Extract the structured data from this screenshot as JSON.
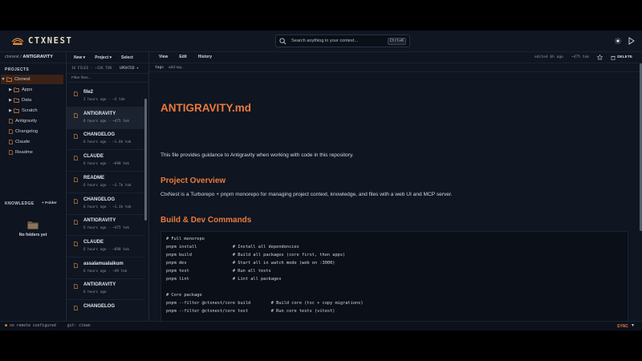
{
  "app": {
    "name": "CTXNEST"
  },
  "search": {
    "placeholder": "Search anything in your context...",
    "shortcut": "Ctrl+K"
  },
  "breadcrumb": {
    "root": "ctxnest",
    "separator": "/",
    "current": "ANTIGRAVITY"
  },
  "list_toolbar": {
    "new_label": "New ▾",
    "project_label": "Project ▾",
    "select_label": "Select"
  },
  "sidebar": {
    "projects_title": "PROJECTS",
    "items": [
      {
        "label": "Ctxnest",
        "type": "folder",
        "expanded": true,
        "active": true
      },
      {
        "label": "Apps",
        "type": "folder"
      },
      {
        "label": "Data",
        "type": "folder"
      },
      {
        "label": "Scratch",
        "type": "folder"
      },
      {
        "label": "Antigravity",
        "type": "file"
      },
      {
        "label": "Changelog",
        "type": "file"
      },
      {
        "label": "Claude",
        "type": "file"
      },
      {
        "label": "Readme",
        "type": "file"
      }
    ],
    "knowledge_title": "KNOWLEDGE",
    "add_folder_label": "+ Folder",
    "empty_text": "No folders yet"
  },
  "file_list": {
    "count_label": "16 FILES · ~11K TOK",
    "sort_label": "UPDATED ▾",
    "filter_placeholder": "Filter files...",
    "files": [
      {
        "name": "file2",
        "meta": "2 hours ago · ~3 tok"
      },
      {
        "name": "ANTIGRAVITY",
        "meta": "6 hours ago · ~475 tok",
        "active": true
      },
      {
        "name": "CHANGELOG",
        "meta": "6 hours ago · ~1.6k tok"
      },
      {
        "name": "CLAUDE",
        "meta": "6 hours ago · ~698 tok"
      },
      {
        "name": "README",
        "meta": "6 hours ago · ~3.7k tok"
      },
      {
        "name": "CHANGELOG",
        "meta": "6 hours ago · ~1.3k tok"
      },
      {
        "name": "ANTIGRAVITY",
        "meta": "6 hours ago · ~475 tok"
      },
      {
        "name": "CLAUDE",
        "meta": "6 hours ago · ~698 tok"
      },
      {
        "name": "assalamualaikum",
        "meta": "6 hours ago · ~49 tok"
      },
      {
        "name": "ANTIGRAVITY",
        "meta": "6 hours ago"
      },
      {
        "name": "CHANGELOG",
        "meta": ""
      }
    ]
  },
  "editor_toolbar": {
    "tabs": [
      "View",
      "Edit",
      "History"
    ],
    "edited": "edited 6h ago",
    "tokens": "~475 tok",
    "delete_label": "DELETE"
  },
  "tags": {
    "label": "tags",
    "add_label": "add tag..."
  },
  "document": {
    "title": "ANTIGRAVITY.md",
    "intro": "This file provides guidance to Antigravity when working with code in this repository.",
    "section1_title": "Project Overview",
    "section1_text": "CtxNest is a Turborepo + pnpm monorepo for managing project context, knowledge, and files with a web UI and MCP server.",
    "section2_title": "Build & Dev Commands",
    "code_lines": [
      "# Full monorepo",
      "pnpm install              # Install all dependencies",
      "pnpm build                # Build all packages (core first, then apps)",
      "pnpm dev                  # Start all in watch mode (web on :3000)",
      "pnpm test                 # Run all tests",
      "pnpm lint                 # Lint all packages",
      "",
      "# Core package",
      "pnpm --filter @ctxnest/core build        # Build core (tsc + copy migrations)",
      "pnpm --filter @ctxnest/core test         # Run core tests (vitest)",
      "",
      "# Web app",
      "pnpm --filter @ctxnest/web dev           # Next.js dev server (:3000)",
      "pnpm --filter @ctxnest/web build         # Production build"
    ]
  },
  "status_bar": {
    "remote": "no remote configured",
    "git": "git: clean",
    "sync_label": "SYNC",
    "more": "▾"
  },
  "colors": {
    "accent": "#ec7a3a",
    "background": "#0f1521",
    "active_project": "#3b2217"
  },
  "icons": [
    "logo-icon",
    "search-icon",
    "sun-icon",
    "menu-icon",
    "folder-icon",
    "file-icon",
    "star-icon",
    "trash-icon"
  ]
}
